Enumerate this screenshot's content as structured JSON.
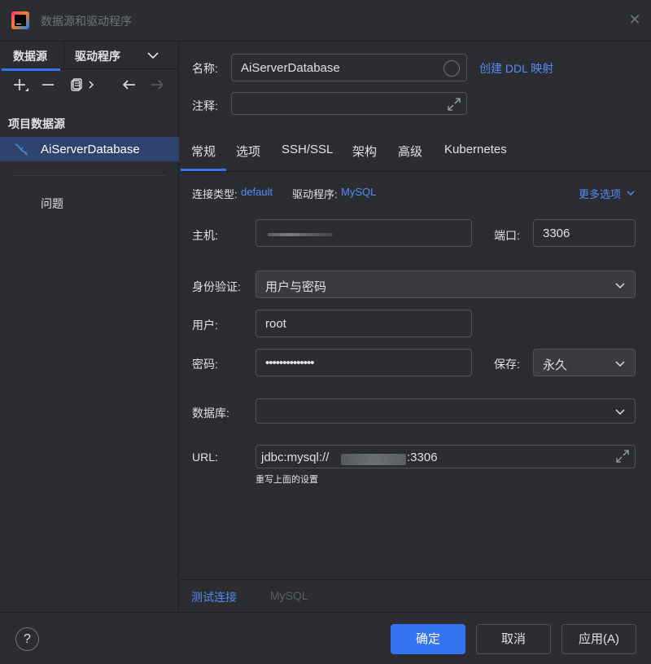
{
  "window": {
    "title": "数据源和驱动程序",
    "close_symbol": "✕"
  },
  "sidebar": {
    "tabs": [
      "数据源",
      "驱动程序"
    ],
    "section_title": "项目数据源",
    "datasource": "AiServerDatabase",
    "problems": "问题"
  },
  "form": {
    "name_label": "名称:",
    "name_value": "AiServerDatabase",
    "create_ddl_link": "创建 DDL 映射",
    "comment_label": "注释:",
    "comment_value": ""
  },
  "tabs": [
    "常规",
    "选项",
    "SSH/SSL",
    "架构",
    "高级",
    "Kubernetes"
  ],
  "general": {
    "conn_type_label": "连接类型:",
    "conn_type_value": "default",
    "driver_label": "驱动程序:",
    "driver_value": "MySQL",
    "more_options": "更多选项",
    "host_label": "主机:",
    "port_label": "端口:",
    "port_value": "3306",
    "auth_label": "身份验证:",
    "auth_value": "用户与密码",
    "user_label": "用户:",
    "user_value": "root",
    "password_label": "密码:",
    "password_value": "••••••••••••••",
    "save_label": "保存:",
    "save_value": "永久",
    "database_label": "数据库:",
    "database_value": "",
    "url_label": "URL:",
    "url_prefix": "jdbc:mysql://",
    "url_suffix": ":3306",
    "url_hint": "重写上面的设置"
  },
  "bottom": {
    "test_connection": "测试连接",
    "driver_name": "MySQL"
  },
  "footer": {
    "help": "?",
    "ok": "确定",
    "cancel": "取消",
    "apply": "应用(A)"
  },
  "colors": {
    "accent": "#3574f0",
    "link": "#548af7",
    "selection": "#2e436e",
    "background": "#2b2d30"
  }
}
